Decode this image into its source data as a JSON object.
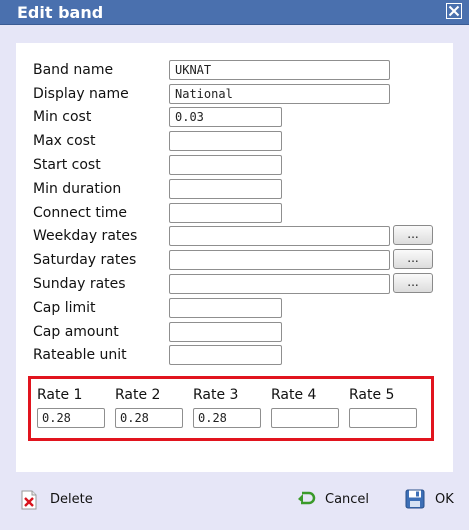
{
  "dialog": {
    "title": "Edit band",
    "close_icon": "close-icon"
  },
  "fields": [
    {
      "label": "Band name",
      "value": "UKNAT",
      "width": "wide",
      "browse": false
    },
    {
      "label": "Display name",
      "value": "National",
      "width": "wide",
      "browse": false
    },
    {
      "label": "Min cost",
      "value": "0.03",
      "width": "narrow",
      "browse": false
    },
    {
      "label": "Max cost",
      "value": "",
      "width": "narrow",
      "browse": false
    },
    {
      "label": "Start cost",
      "value": "",
      "width": "narrow",
      "browse": false
    },
    {
      "label": "Min duration",
      "value": "",
      "width": "narrow",
      "browse": false
    },
    {
      "label": "Connect time",
      "value": "",
      "width": "narrow",
      "browse": false
    },
    {
      "label": "Weekday rates",
      "value": "",
      "width": "wide",
      "browse": true
    },
    {
      "label": "Saturday rates",
      "value": "",
      "width": "wide",
      "browse": true
    },
    {
      "label": "Sunday rates",
      "value": "",
      "width": "wide",
      "browse": true
    },
    {
      "label": "Cap limit",
      "value": "",
      "width": "narrow",
      "browse": false
    },
    {
      "label": "Cap amount",
      "value": "",
      "width": "narrow",
      "browse": false
    },
    {
      "label": "Rateable unit",
      "value": "",
      "width": "narrow",
      "browse": false
    }
  ],
  "browse_label": "...",
  "rates": [
    {
      "label": "Rate 1",
      "value": "0.28"
    },
    {
      "label": "Rate 2",
      "value": "0.28"
    },
    {
      "label": "Rate 3",
      "value": "0.28"
    },
    {
      "label": "Rate 4",
      "value": ""
    },
    {
      "label": "Rate 5",
      "value": ""
    }
  ],
  "highlight_color": "#e1141e",
  "footer": {
    "delete_label": "Delete",
    "cancel_label": "Cancel",
    "ok_label": "OK"
  }
}
